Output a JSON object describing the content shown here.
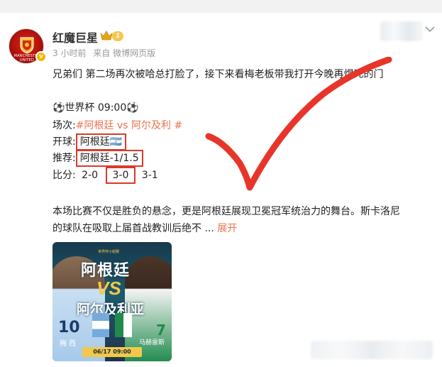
{
  "user": {
    "name": "红魔巨星",
    "level": "1",
    "meta_time": "3 小时前",
    "meta_source": "来自 微博网页版",
    "avatar_caption": "MANCHESTER UNITED"
  },
  "post": {
    "line1": "兄弟们 第二场再次被哈总打脸了，接下来看梅老板带我打开今晚再焊死的门",
    "line2": "⚽世界杯 09:00⚽",
    "match_label": "场次:",
    "match_tag": "#阿根廷 vs 阿尔及利 #",
    "kickoff_label": "开球:",
    "kickoff_value": "阿根廷🇦🇷",
    "tip_label": "推荐:",
    "tip_value": "阿根廷-1/1.5",
    "score_label": "比分:",
    "score_1": "2-0",
    "score_2": "3-0",
    "score_3": "3-1",
    "body_line1": "本场比赛不仅是胜负的悬念，更是阿根廷展现卫冕冠军统治力的舞台。斯卡洛尼",
    "body_line2": "的球队在吸取上届首战教训后绝不 ...",
    "expand_label": "展开"
  },
  "image": {
    "cup_text": "世界杯小组赛",
    "title_a": "阿根廷",
    "vs": "VS",
    "title_b": "阿尔及利亚",
    "player_left": "梅 西",
    "player_right": "马赫雷斯",
    "number_left": "10",
    "number_right": "7",
    "date": "06/17 09:00"
  },
  "colors": {
    "accent": "#eb7350",
    "box_border": "#d83a2c",
    "checkmark": "#e8352a"
  }
}
